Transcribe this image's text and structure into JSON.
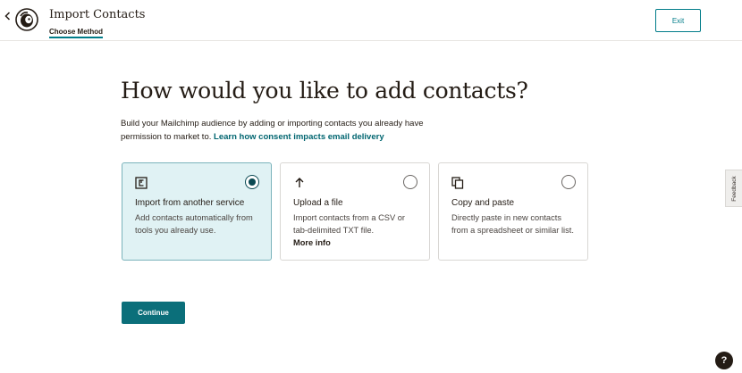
{
  "header": {
    "back_icon": "chevron-left-icon",
    "logo_icon": "mailchimp-logo-icon",
    "title": "Import Contacts",
    "breadcrumb": "Choose Method",
    "exit_label": "Exit"
  },
  "main": {
    "heading": "How would you like to add contacts?",
    "intro_text": "Build your Mailchimp audience by adding or importing contacts you already have permission to market to.",
    "intro_link": "Learn how consent impacts email delivery",
    "cards": [
      {
        "icon": "import-service-icon",
        "title": "Import from another service",
        "description": "Add contacts automatically from tools you already use.",
        "selected": true
      },
      {
        "icon": "upload-arrow-icon",
        "title": "Upload a file",
        "description": "Import contacts from a CSV or tab-delimited TXT file.",
        "more_link": "More info",
        "selected": false
      },
      {
        "icon": "copy-icon",
        "title": "Copy and paste",
        "description": "Directly paste in new contacts from a spreadsheet or similar list.",
        "selected": false
      }
    ],
    "continue_label": "Continue"
  },
  "feedback_label": "Feedback",
  "help_label": "?",
  "colors": {
    "accent": "#007c89",
    "button": "#0b6f7a",
    "selected_card_bg": "#e0f2f4",
    "text": "#241c15"
  }
}
